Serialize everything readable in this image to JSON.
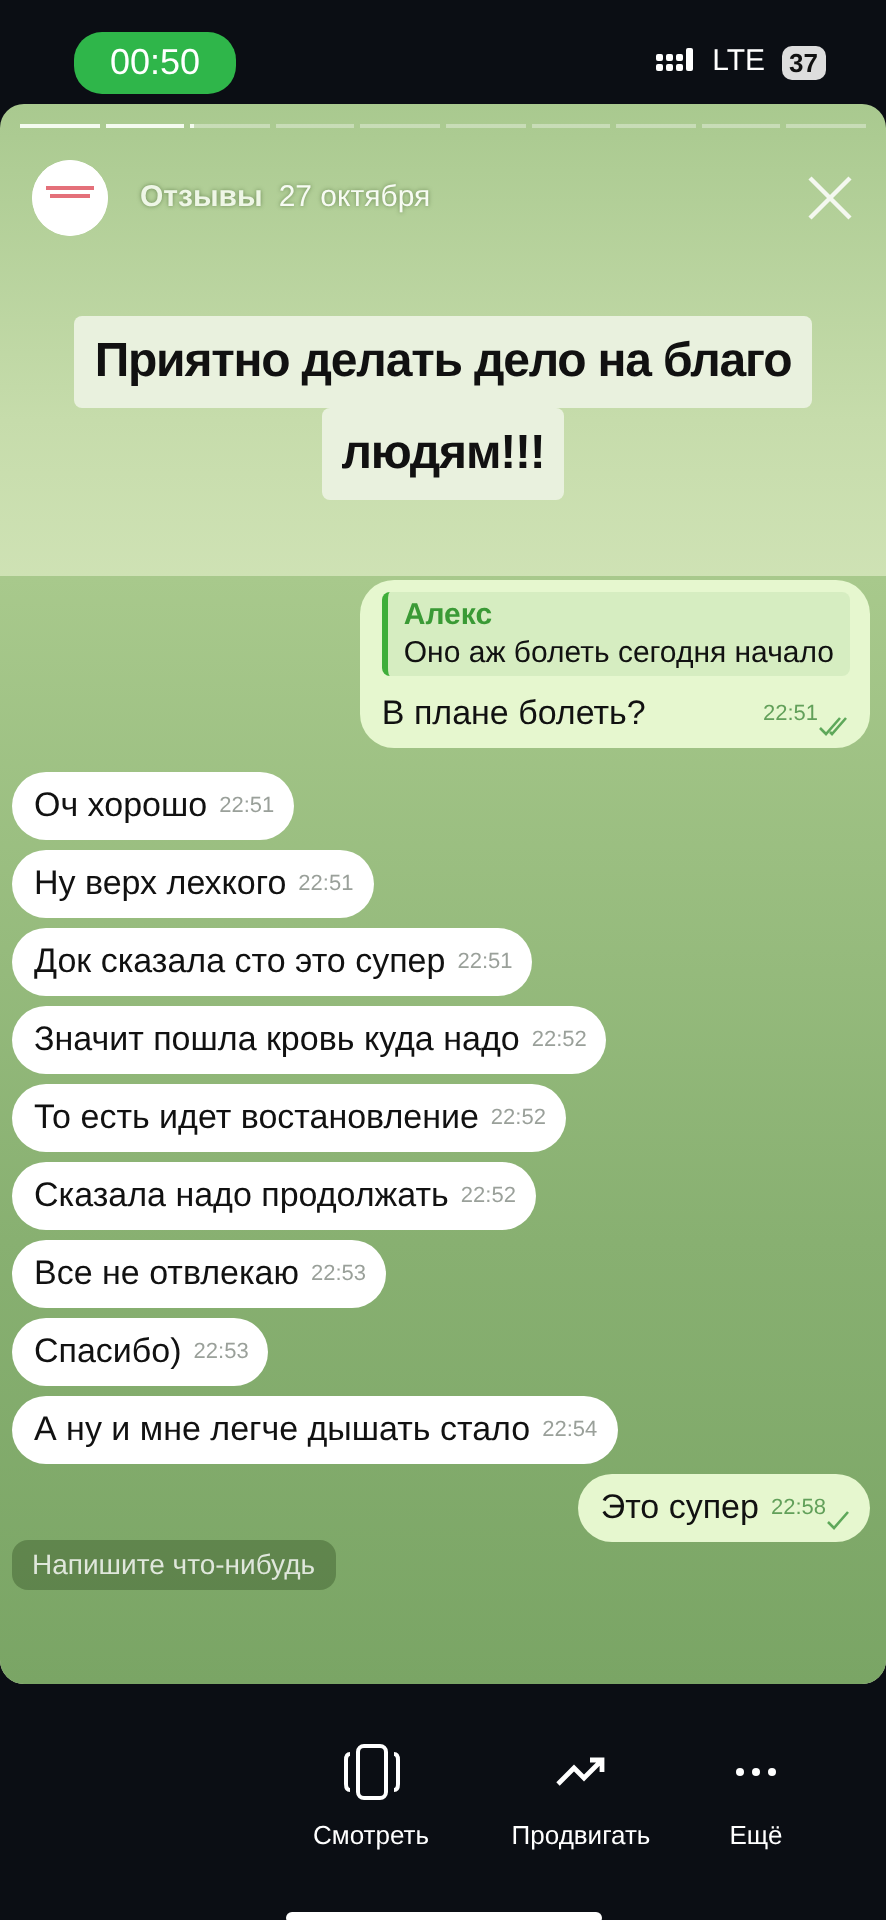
{
  "status_bar": {
    "time": "00:50",
    "network": "LTE",
    "battery": "37"
  },
  "story": {
    "progress": [
      {
        "level": 1
      },
      {
        "level": 1
      },
      {
        "level": 0.05
      },
      {
        "level": 0
      },
      {
        "level": 0
      },
      {
        "level": 0
      },
      {
        "level": 0
      },
      {
        "level": 0
      },
      {
        "level": 0
      },
      {
        "level": 0
      }
    ],
    "author": "Отзывы",
    "date": "27 октября",
    "headline": [
      "Приятно делать дело на благо",
      "людям!!!"
    ],
    "chat": {
      "messages": [
        {
          "kind": "out",
          "reply_name": "Алекс",
          "reply_text": "Оно аж болеть сегодня начало",
          "text": "В плане болеть?",
          "time": "22:51",
          "read": true
        },
        {
          "kind": "in",
          "text": "Оч хорошо",
          "time": "22:51"
        },
        {
          "kind": "in",
          "text": "Ну верх лехкого",
          "time": "22:51"
        },
        {
          "kind": "in",
          "text": "Док сказала сто это супер",
          "time": "22:51"
        },
        {
          "kind": "in",
          "text": "Значит пошла кровь куда надо",
          "time": "22:52"
        },
        {
          "kind": "in",
          "text": "То есть идет востановление",
          "time": "22:52"
        },
        {
          "kind": "in",
          "text": "Сказала надо продолжать",
          "time": "22:52"
        },
        {
          "kind": "in",
          "text": "Все не отвлекаю",
          "time": "22:53"
        },
        {
          "kind": "in",
          "text": "Спасибо)",
          "time": "22:53"
        },
        {
          "kind": "in",
          "text": "А ну и мне легче дышать стало",
          "time": "22:54"
        },
        {
          "kind": "out",
          "text": "Это супер",
          "time": "22:58",
          "read": false
        }
      ],
      "input_placeholder": "Напишите что-нибудь"
    }
  },
  "actions": [
    {
      "kind": "view",
      "label": "Смотреть"
    },
    {
      "kind": "promote",
      "label": "Продвигать"
    },
    {
      "kind": "more",
      "label": "Ещё"
    }
  ]
}
